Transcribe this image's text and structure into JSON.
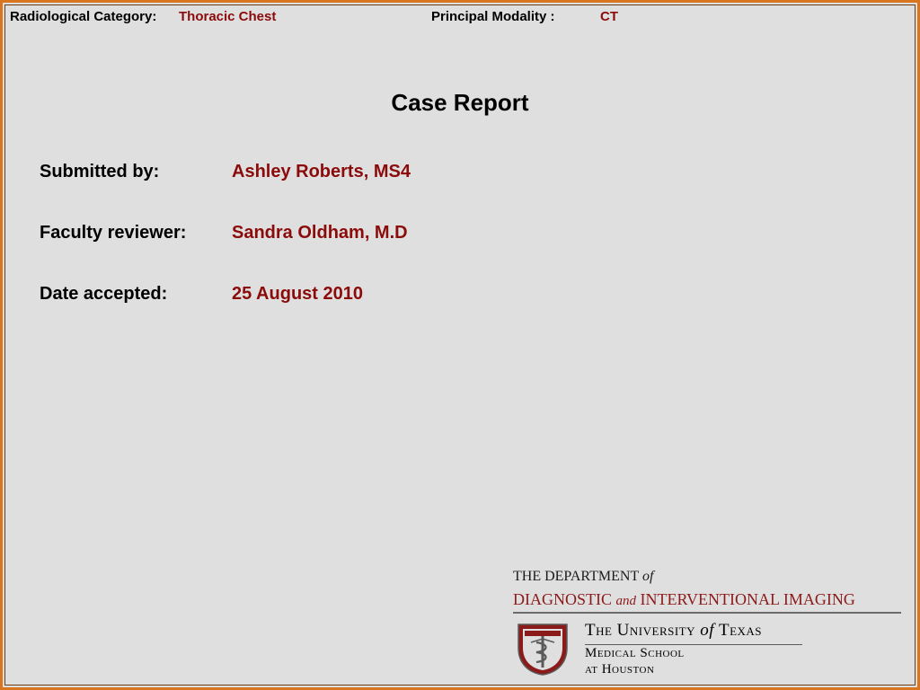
{
  "header": {
    "category_label": "Radiological Category:",
    "category_value": "Thoracic Chest",
    "modality_label": "Principal Modality :",
    "modality_value": "CT"
  },
  "title": "Case Report",
  "fields": [
    {
      "label": "Submitted by:",
      "value": "Ashley Roberts, MS4"
    },
    {
      "label": "Faculty reviewer:",
      "value": "Sandra Oldham, M.D"
    },
    {
      "label": "Date accepted:",
      "value": "25 August 2010"
    }
  ],
  "logo": {
    "dept_prefix": "THE DEPARTMENT",
    "dept_of": "of",
    "dept_name_1": "DIAGNOSTIC",
    "dept_and": "and",
    "dept_name_2": "INTERVENTIONAL IMAGING",
    "ut_the": "The University",
    "ut_of": "of",
    "ut_texas": "Texas",
    "ms_line1": "Medical School",
    "ms_line2": "at Houston"
  },
  "colors": {
    "value_red": "#8b0a0a",
    "border_orange": "#d9751e",
    "background": "#dfdfdf",
    "logo_red": "#8b1a1a"
  }
}
